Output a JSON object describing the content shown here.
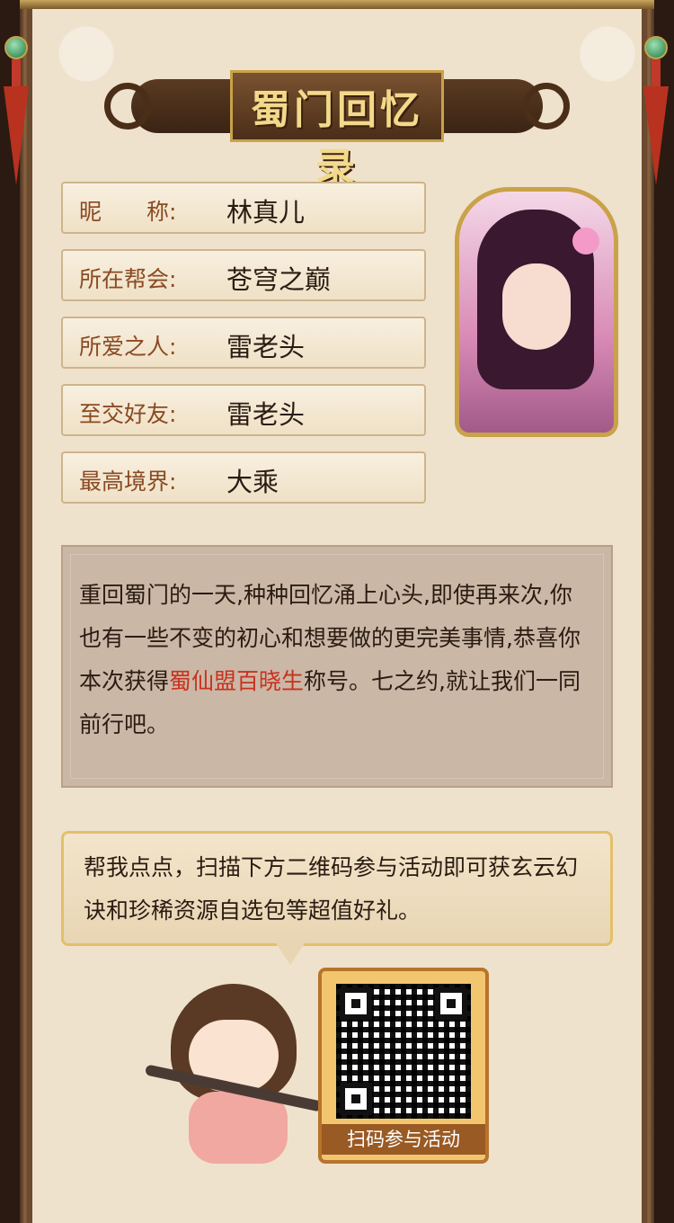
{
  "banner": {
    "title": "蜀门回忆录"
  },
  "profile": {
    "fields": [
      {
        "label": "昵　　称:",
        "value": "林真儿"
      },
      {
        "label": "所在帮会:",
        "value": "苍穹之巅"
      },
      {
        "label": "所爱之人:",
        "value": "雷老头"
      },
      {
        "label": "至交好友:",
        "value": "雷老头"
      },
      {
        "label": "最高境界:",
        "value": "大乘"
      }
    ]
  },
  "story": {
    "before": "重回蜀门的一天,种种回忆涌上心头,即使再来次,你也有一些不变的初心和想要做的更完美事情,恭喜你本次获得",
    "highlight": "蜀仙盟百晓生",
    "after": "称号。七之约,就让我们一同前行吧。"
  },
  "speech": {
    "text": "帮我点点，扫描下方二维码参与活动即可获玄云幻诀和珍稀资源自选包等超值好礼。"
  },
  "qr": {
    "caption": "扫码参与活动"
  },
  "colors": {
    "accent_red": "#c8321e",
    "label_brown": "#8a4a22",
    "gold": "#c9a24a"
  }
}
